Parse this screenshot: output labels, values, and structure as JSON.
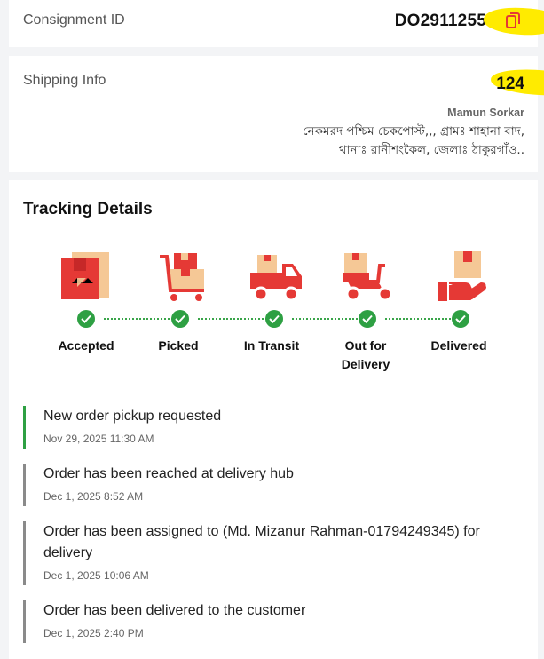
{
  "consignment": {
    "label": "Consignment ID",
    "value": "DO2911255",
    "copy_icon": "copy-icon"
  },
  "shipping": {
    "label": "Shipping Info",
    "phone_suffix": "124",
    "name": "Mamun Sorkar",
    "address_line1": "নেকমরদ পশ্চিম চেকপোস্ট,,, গ্রামঃ শাহানা বাদ,",
    "address_line2": "থানাঃ রানীশংকৈল, জেলাঃ ঠাকুরগাঁও.."
  },
  "tracking": {
    "title": "Tracking Details",
    "steps": [
      {
        "label": "Accepted",
        "icon": "accepted-box-icon",
        "done": true
      },
      {
        "label": "Picked",
        "icon": "cart-icon",
        "done": true
      },
      {
        "label": "In Transit",
        "icon": "truck-icon",
        "done": true
      },
      {
        "label": "Out for Delivery",
        "icon": "scooter-icon",
        "done": true
      },
      {
        "label": "Delivered",
        "icon": "hand-box-icon",
        "done": true
      }
    ],
    "events": [
      {
        "title": "New order pickup requested",
        "time": "Nov 29, 2025 11:30 AM",
        "active": true
      },
      {
        "title": "Order has been reached at delivery hub",
        "time": "Dec 1, 2025 8:52 AM",
        "active": false
      },
      {
        "title": "Order has been assigned to (Md. Mizanur Rahman-01794249345) for delivery",
        "time": "Dec 1, 2025 10:06 AM",
        "active": false
      },
      {
        "title": "Order has been delivered to the customer",
        "time": "Dec 1, 2025 2:40 PM",
        "active": false
      }
    ]
  },
  "colors": {
    "accent_red": "#e53935",
    "box_tan": "#f5c896",
    "done_green": "#2ea043",
    "highlight": "#ffeb00"
  }
}
